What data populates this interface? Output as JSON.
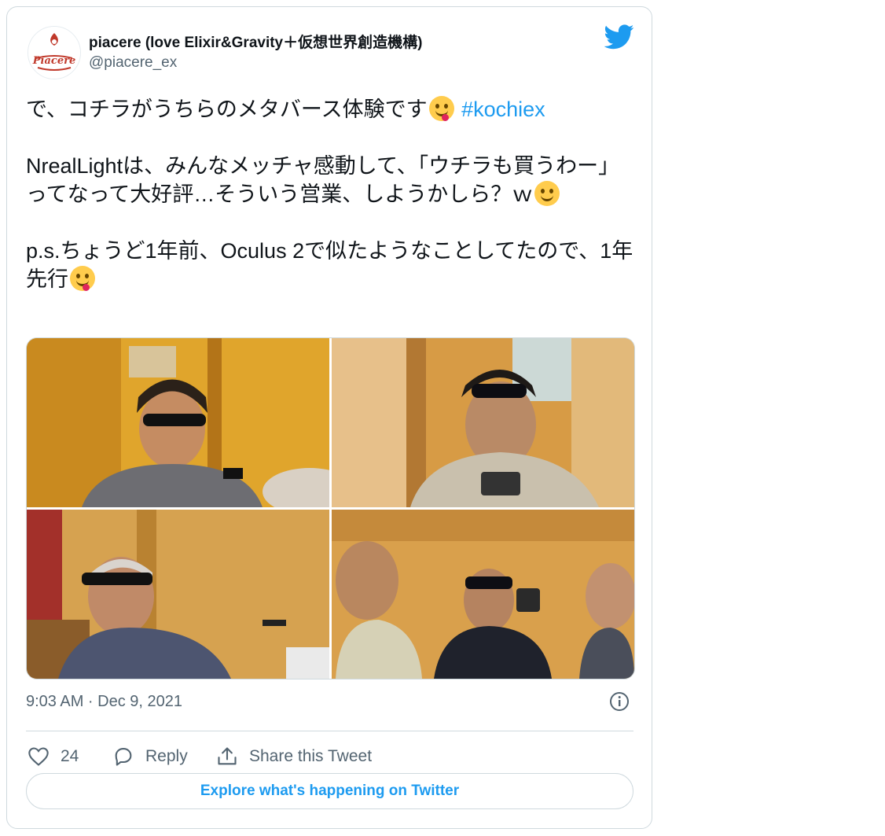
{
  "author": {
    "name": "piacere (love Elixir&Gravity＋仮想世界創造機構)",
    "handle": "@piacere_ex",
    "avatar_text": "Piacere"
  },
  "tweet": {
    "line1": "で、コチラがうちらのメタバース体験です",
    "hashtag": "#kochiex",
    "line2": "NrealLightは、みんなメッチャ感動して、「ウチラも買うわー」ってなって大好評…そういう営業、しようかしら？ｗ",
    "line3": "p.s.ちょうど1年前、Oculus 2で似たようなことしてたので、1年先行",
    "emojis": [
      "face-savoring-food",
      "winking-face",
      "winking-face-with-tongue"
    ]
  },
  "media": {
    "photos": [
      "photo-1",
      "photo-2",
      "photo-3",
      "photo-4"
    ]
  },
  "timestamp": "9:03 AM · Dec 9, 2021",
  "actions": {
    "like_count": "24",
    "reply_label": "Reply",
    "share_label": "Share this Tweet"
  },
  "explore_label": "Explore what's happening on Twitter",
  "colors": {
    "accent": "#1d9bf0",
    "text": "#0f1419",
    "muted": "#536471",
    "border": "#cfd9de"
  }
}
